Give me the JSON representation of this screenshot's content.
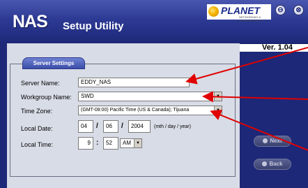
{
  "header": {
    "logo": "NAS",
    "title": "Setup Utility",
    "brand": "PLANET",
    "brand_tagline": "NETWORKING & COMMUNICATION",
    "minimize_icon": "⊖",
    "close_icon": "⊗"
  },
  "version": "Ver. 1.04",
  "group_title": "Server Settings",
  "form": {
    "server_name": {
      "label": "Server Name:",
      "value": "EDDY_NAS"
    },
    "workgroup_name": {
      "label": "Workgroup Name:",
      "value": "SWD"
    },
    "time_zone": {
      "label": "Time Zone:",
      "value": "(GMT-08:00) Pacific Time (US & Canada); Tijuana"
    },
    "local_date": {
      "label": "Local Date:",
      "month": "04",
      "day": "06",
      "year": "2004",
      "separator": "/",
      "hint": "(mth / day / year)"
    },
    "local_time": {
      "label": "Local Time:",
      "hour": "9",
      "minute": "52",
      "separator": ":",
      "ampm": "AM"
    }
  },
  "buttons": {
    "next": "Next",
    "back": "Back"
  },
  "colors": {
    "title_bar": "#2d3a94",
    "panel": "#d8dce6",
    "arrow": "#e00000"
  }
}
